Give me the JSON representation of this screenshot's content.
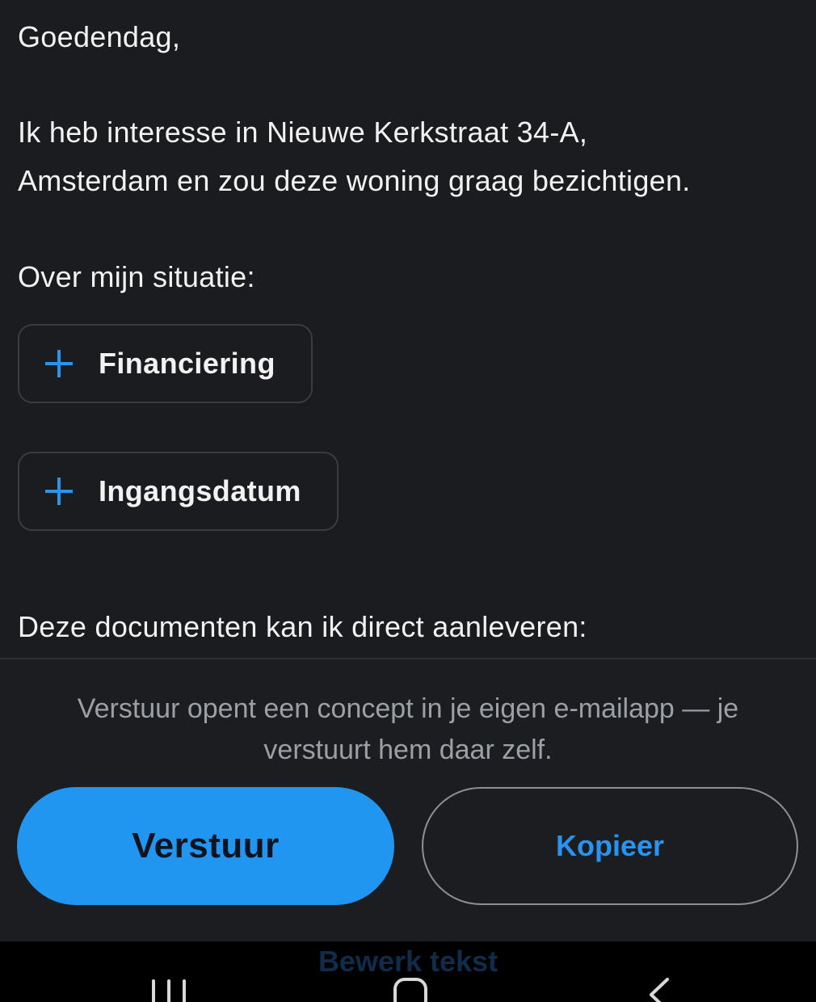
{
  "message": {
    "greeting": "Goedendag,",
    "interest_line1": "Ik heb interesse in Nieuwe Kerkstraat 34-A,",
    "interest_line2": "Amsterdam en zou deze woning graag bezichtigen.",
    "situation_heading": "Over mijn situatie:",
    "chips": [
      {
        "label": "Financiering",
        "icon": "plus-icon"
      },
      {
        "label": "Ingangsdatum",
        "icon": "plus-icon"
      }
    ],
    "documents_heading": "Deze documenten kan ik direct aanleveren:"
  },
  "footer": {
    "notice": "Verstuur opent een concept in je eigen e-mailapp — je verstuurt hem daar zelf.",
    "send_label": "Verstuur",
    "copy_label": "Kopieer",
    "edit_label": "Bewerk tekst"
  },
  "colors": {
    "background": "#1b1c1f",
    "accent": "#2196f0",
    "text": "#f2f2f2",
    "muted": "#9b9fa6"
  },
  "system_nav": {
    "icons": [
      "recent-apps-icon",
      "home-icon",
      "back-icon"
    ]
  }
}
